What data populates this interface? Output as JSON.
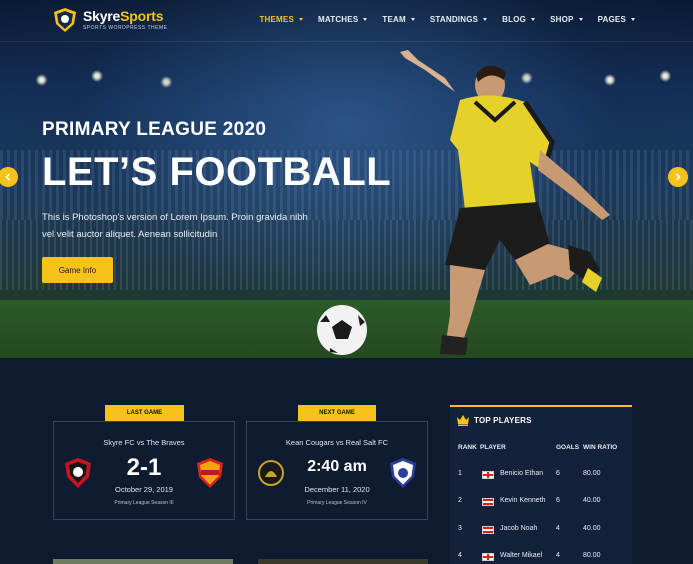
{
  "brand": {
    "name_part1": "Skyre",
    "name_part2": "Sports",
    "tagline": "SPORTS WORDPRESS THEME",
    "accent_color": "#f7c21b"
  },
  "nav": {
    "items": [
      {
        "label": "THEMES",
        "active": true
      },
      {
        "label": "MATCHES"
      },
      {
        "label": "TEAM"
      },
      {
        "label": "STANDINGS"
      },
      {
        "label": "BLOG"
      },
      {
        "label": "SHOP"
      },
      {
        "label": "PAGES"
      }
    ]
  },
  "hero": {
    "subtitle": "PRIMARY LEAGUE 2020",
    "title": "LET’S FOOTBALL",
    "description": "This is Photoshop's version of Lorem Ipsum. Proin gravida nibh vel velit auctor aliquet. Aenean sollicitudin",
    "button_label": "Game Info",
    "prev_icon": "chevron-left-icon",
    "next_icon": "chevron-right-icon"
  },
  "last_game": {
    "tag": "LAST GAME",
    "title": "Skyre FC vs The Braves",
    "score": "2-1",
    "date": "October 29, 2019",
    "season": "Primary League Season III"
  },
  "next_game": {
    "tag": "NEXT GAME",
    "title": "Kean Cougars vs Real Salt FC",
    "time": "2:40 am",
    "date": "December 11, 2020",
    "season": "Primary League Season IV"
  },
  "top_players": {
    "title": "TOP PLAYERS",
    "icon": "crown-icon",
    "columns": [
      "RANK",
      "PLAYER",
      "GOALS",
      "WIN RATIO"
    ],
    "rows": [
      {
        "rank": "1",
        "flag": "england",
        "player": "Benicio Ethan",
        "goals": "6",
        "win_ratio": "80.00"
      },
      {
        "rank": "2",
        "flag": "austria",
        "player": "Kevin Kenneth",
        "goals": "6",
        "win_ratio": "40.00"
      },
      {
        "rank": "3",
        "flag": "austria",
        "player": "Jacob Noah",
        "goals": "4",
        "win_ratio": "40.00"
      },
      {
        "rank": "4",
        "flag": "england",
        "player": "Walter Mikael",
        "goals": "4",
        "win_ratio": "80.00"
      }
    ]
  }
}
